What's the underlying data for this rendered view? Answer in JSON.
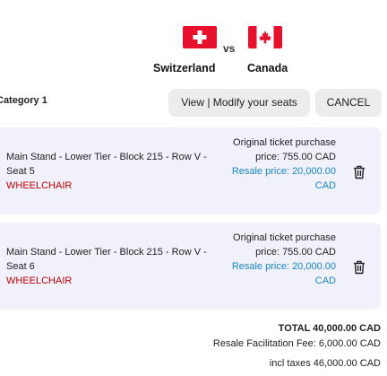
{
  "match": {
    "vs_label": "vs",
    "home_team": "Switzerland",
    "away_team": "Canada",
    "home_flag_icon": "swiss-flag-icon",
    "away_flag_icon": "canadian-flag-icon"
  },
  "section": {
    "category_label": "Category 1",
    "view_modify_label": "View | Modify your seats",
    "cancel_label": "CANCEL"
  },
  "tickets": [
    {
      "seat": "Main Stand - Lower Tier - Block 215 - Row V - Seat 5",
      "tag": "WHEELCHAIR",
      "original_price_label": "Original ticket purchase price: 755.00 CAD",
      "resale_price_label": "Resale price: 20,000.00 CAD",
      "delete_icon": "trash-icon"
    },
    {
      "seat": "Main Stand - Lower Tier - Block 215 - Row V - Seat 6",
      "tag": "WHEELCHAIR",
      "original_price_label": "Original ticket purchase price: 755.00 CAD",
      "resale_price_label": "Resale price: 20,000.00 CAD",
      "delete_icon": "trash-icon"
    }
  ],
  "totals": {
    "total": "TOTAL 40,000.00 CAD",
    "fee": "Resale Facilitation Fee: 6,000.00 CAD",
    "incl_taxes": "incl taxes 46,000.00 CAD"
  },
  "colors": {
    "tag": "#c00000",
    "resale": "#1a86c8",
    "card_bg": "#f0f1fb",
    "flag_red": "#e8112d"
  }
}
